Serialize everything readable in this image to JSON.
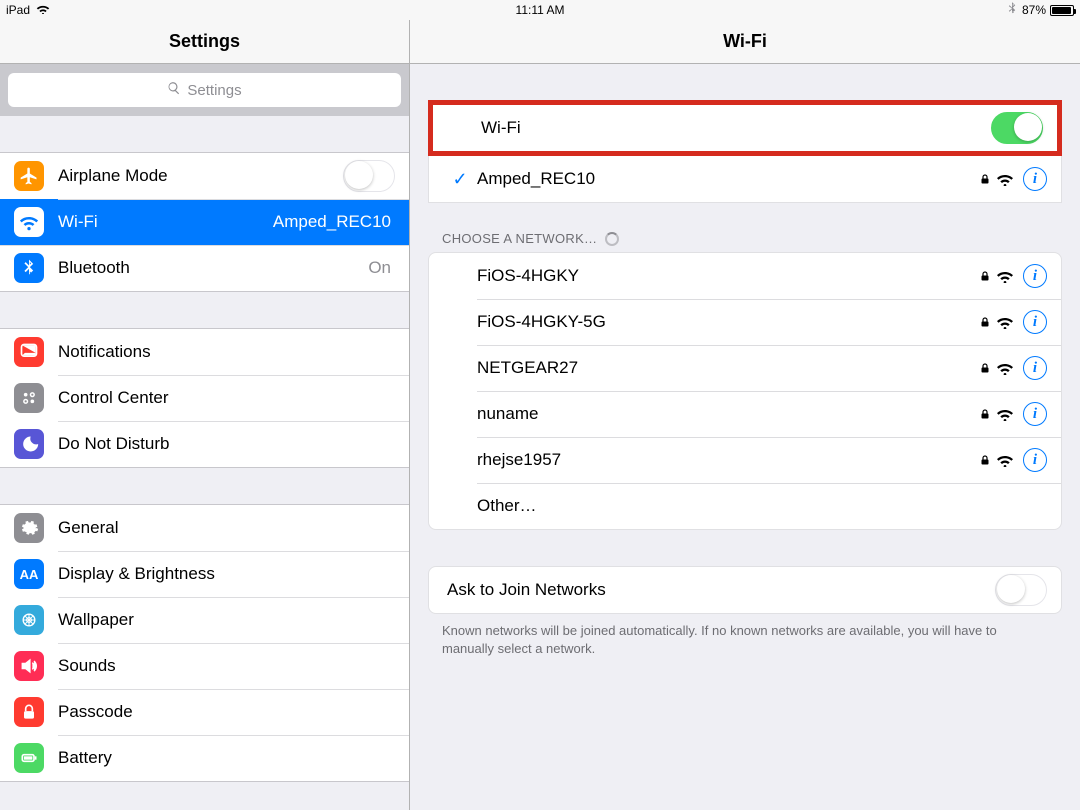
{
  "statusbar": {
    "device": "iPad",
    "time": "11:11 AM",
    "battery_pct": "87%"
  },
  "sidebar": {
    "title": "Settings",
    "search_placeholder": "Settings",
    "groups": [
      {
        "items": [
          {
            "label": "Airplane Mode",
            "switch": "off"
          },
          {
            "label": "Wi-Fi",
            "value": "Amped_REC10",
            "selected": true
          },
          {
            "label": "Bluetooth",
            "value": "On"
          }
        ]
      },
      {
        "items": [
          {
            "label": "Notifications"
          },
          {
            "label": "Control Center"
          },
          {
            "label": "Do Not Disturb"
          }
        ]
      },
      {
        "items": [
          {
            "label": "General"
          },
          {
            "label": "Display & Brightness"
          },
          {
            "label": "Wallpaper"
          },
          {
            "label": "Sounds"
          },
          {
            "label": "Passcode"
          },
          {
            "label": "Battery"
          }
        ]
      }
    ]
  },
  "detail": {
    "title": "Wi-Fi",
    "wifi_toggle": {
      "label": "Wi-Fi",
      "state": "on"
    },
    "connected": {
      "name": "Amped_REC10",
      "locked": true
    },
    "choose_header": "Choose a Network…",
    "networks": [
      {
        "name": "FiOS-4HGKY",
        "locked": true
      },
      {
        "name": "FiOS-4HGKY-5G",
        "locked": true
      },
      {
        "name": "NETGEAR27",
        "locked": true
      },
      {
        "name": "nuname",
        "locked": true
      },
      {
        "name": "rhejse1957",
        "locked": true
      }
    ],
    "other_label": "Other…",
    "ask_to_join": {
      "label": "Ask to Join Networks",
      "state": "off"
    },
    "ask_footer": "Known networks will be joined automatically. If no known networks are available, you will have to manually select a network."
  }
}
